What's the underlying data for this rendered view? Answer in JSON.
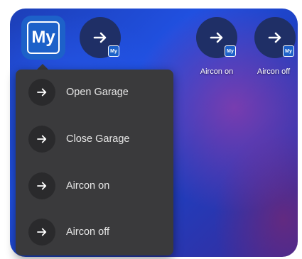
{
  "app": {
    "icon_text": "My"
  },
  "shortcuts": [
    {
      "label": "Aircon on",
      "badge": "My"
    },
    {
      "label": "Aircon off",
      "badge": "My"
    }
  ],
  "unlabeled_shortcut": {
    "badge": "My"
  },
  "menu": {
    "items": [
      {
        "label": "Open Garage",
        "icon": "arrow-right-icon"
      },
      {
        "label": "Close Garage",
        "icon": "arrow-right-icon"
      },
      {
        "label": "Aircon on",
        "icon": "arrow-right-icon"
      },
      {
        "label": "Aircon off",
        "icon": "arrow-right-icon"
      }
    ]
  },
  "colors": {
    "app_icon_bg": "#1d61c9",
    "menu_bg": "#3a3a3c",
    "shortcut_bg": "#1f2f66"
  }
}
